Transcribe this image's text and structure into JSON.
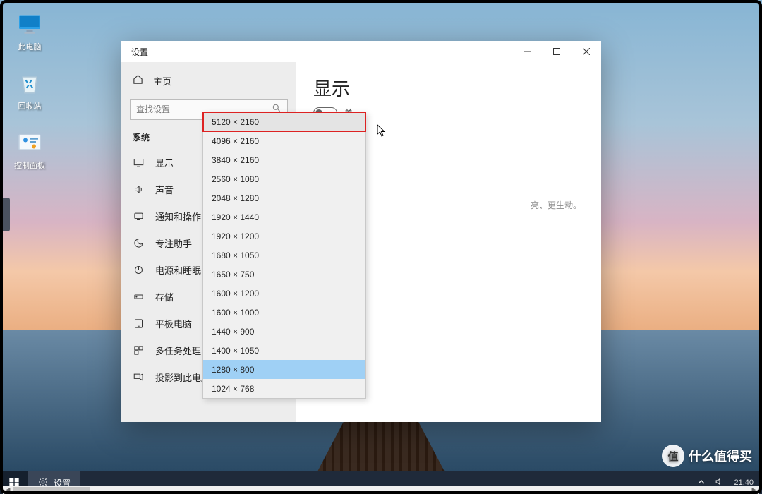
{
  "desktop_icons": [
    {
      "id": "this-pc",
      "label": "此电脑"
    },
    {
      "id": "recycle-bin",
      "label": "回收站"
    },
    {
      "id": "control-panel",
      "label": "控制面板"
    }
  ],
  "window": {
    "title": "设置",
    "sidebar": {
      "home": "主页",
      "search_placeholder": "查找设置",
      "category": "系统",
      "items": [
        {
          "id": "display",
          "label": "显示"
        },
        {
          "id": "sound",
          "label": "声音"
        },
        {
          "id": "notifications",
          "label": "通知和操作"
        },
        {
          "id": "focus-assist",
          "label": "专注助手"
        },
        {
          "id": "power-sleep",
          "label": "电源和睡眠"
        },
        {
          "id": "storage",
          "label": "存储"
        },
        {
          "id": "tablet",
          "label": "平板电脑"
        },
        {
          "id": "multitask",
          "label": "多任务处理"
        },
        {
          "id": "project",
          "label": "投影到此电脑"
        }
      ]
    },
    "main": {
      "heading": "显示",
      "toggle_state": "关",
      "hint_fragment": "亮、更生动。"
    }
  },
  "resolution_dropdown": {
    "highlighted": "5120 × 2160",
    "selected": "1280 × 800",
    "options": [
      "5120 × 2160",
      "4096 × 2160",
      "3840 × 2160",
      "2560 × 1080",
      "2048 × 1280",
      "1920 × 1440",
      "1920 × 1200",
      "1680 × 1050",
      "1650 × 750",
      "1600 × 1200",
      "1600 × 1000",
      "1440 × 900",
      "1400 × 1050",
      "1280 × 800",
      "1024 × 768"
    ]
  },
  "taskbar": {
    "app_label": "设置",
    "time": "21:40"
  },
  "watermark": {
    "badge": "值",
    "text": "什么值得买"
  }
}
